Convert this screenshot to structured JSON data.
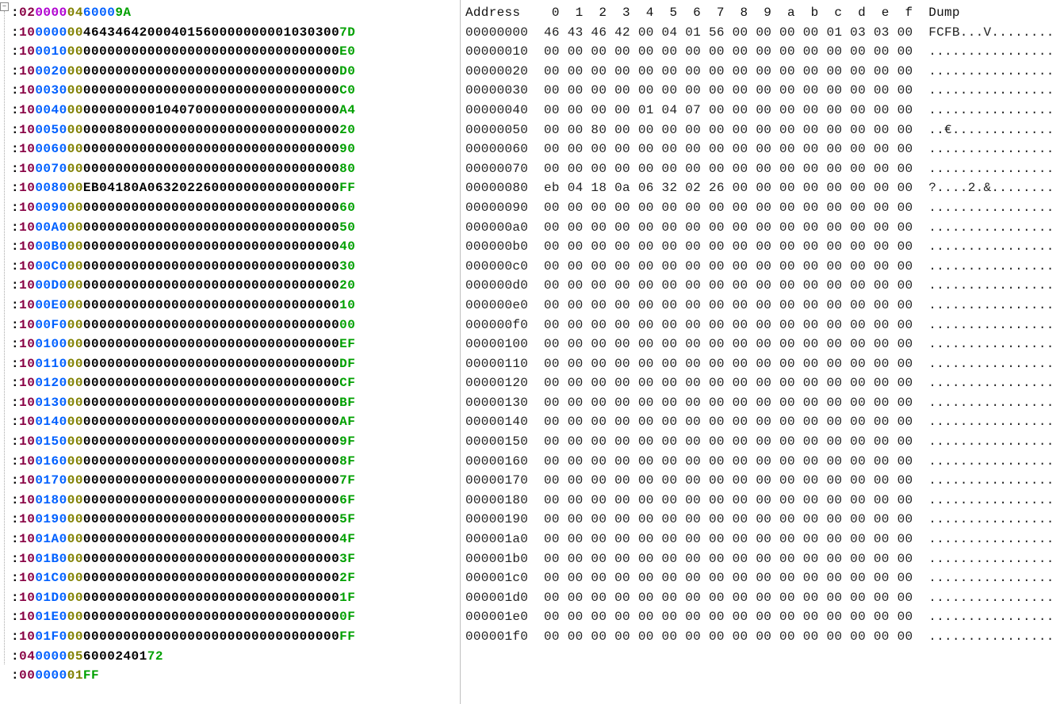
{
  "intel_hex": {
    "first_record": {
      "colon": ":",
      "bc": "02",
      "addr_purple": "0000",
      "type": "04",
      "data_addr_blue": "6000",
      "checksum": "9A"
    },
    "records": [
      {
        "bc": "10",
        "addr": "0000",
        "type": "00",
        "data": "4643464200040156000000000103030",
        "data_tail": "0",
        "ck": "7D"
      },
      {
        "bc": "10",
        "addr": "0010",
        "type": "00",
        "data": "0000000000000000000000000000000",
        "data_tail": "0",
        "ck": "E0"
      },
      {
        "bc": "10",
        "addr": "0020",
        "type": "00",
        "data": "0000000000000000000000000000000",
        "data_tail": "0",
        "ck": "D0"
      },
      {
        "bc": "10",
        "addr": "0030",
        "type": "00",
        "data": "0000000000000000000000000000000",
        "data_tail": "0",
        "ck": "C0"
      },
      {
        "bc": "10",
        "addr": "0040",
        "type": "00",
        "data": "0000000001040700000000000000000",
        "data_tail": "0",
        "ck": "A4"
      },
      {
        "bc": "10",
        "addr": "0050",
        "type": "00",
        "data": "0000800000000000000000000000000",
        "data_tail": "0",
        "ck": "20"
      },
      {
        "bc": "10",
        "addr": "0060",
        "type": "00",
        "data": "0000000000000000000000000000000",
        "data_tail": "0",
        "ck": "90"
      },
      {
        "bc": "10",
        "addr": "0070",
        "type": "00",
        "data": "0000000000000000000000000000000",
        "data_tail": "0",
        "ck": "80"
      },
      {
        "bc": "10",
        "addr": "0080",
        "type": "00",
        "data": "EB04180A06320226000000000000000",
        "data_tail": "0",
        "ck": "FF"
      },
      {
        "bc": "10",
        "addr": "0090",
        "type": "00",
        "data": "0000000000000000000000000000000",
        "data_tail": "0",
        "ck": "60"
      },
      {
        "bc": "10",
        "addr": "00A0",
        "type": "00",
        "data": "0000000000000000000000000000000",
        "data_tail": "0",
        "ck": "50"
      },
      {
        "bc": "10",
        "addr": "00B0",
        "type": "00",
        "data": "0000000000000000000000000000000",
        "data_tail": "0",
        "ck": "40"
      },
      {
        "bc": "10",
        "addr": "00C0",
        "type": "00",
        "data": "0000000000000000000000000000000",
        "data_tail": "0",
        "ck": "30"
      },
      {
        "bc": "10",
        "addr": "00D0",
        "type": "00",
        "data": "0000000000000000000000000000000",
        "data_tail": "0",
        "ck": "20"
      },
      {
        "bc": "10",
        "addr": "00E0",
        "type": "00",
        "data": "0000000000000000000000000000000",
        "data_tail": "0",
        "ck": "10"
      },
      {
        "bc": "10",
        "addr": "00F0",
        "type": "00",
        "data": "0000000000000000000000000000000",
        "data_tail": "0",
        "ck": "00"
      },
      {
        "bc": "10",
        "addr": "0100",
        "type": "00",
        "data": "0000000000000000000000000000000",
        "data_tail": "0",
        "ck": "EF"
      },
      {
        "bc": "10",
        "addr": "0110",
        "type": "00",
        "data": "0000000000000000000000000000000",
        "data_tail": "0",
        "ck": "DF"
      },
      {
        "bc": "10",
        "addr": "0120",
        "type": "00",
        "data": "0000000000000000000000000000000",
        "data_tail": "0",
        "ck": "CF"
      },
      {
        "bc": "10",
        "addr": "0130",
        "type": "00",
        "data": "0000000000000000000000000000000",
        "data_tail": "0",
        "ck": "BF"
      },
      {
        "bc": "10",
        "addr": "0140",
        "type": "00",
        "data": "0000000000000000000000000000000",
        "data_tail": "0",
        "ck": "AF"
      },
      {
        "bc": "10",
        "addr": "0150",
        "type": "00",
        "data": "0000000000000000000000000000000",
        "data_tail": "0",
        "ck": "9F"
      },
      {
        "bc": "10",
        "addr": "0160",
        "type": "00",
        "data": "0000000000000000000000000000000",
        "data_tail": "0",
        "ck": "8F"
      },
      {
        "bc": "10",
        "addr": "0170",
        "type": "00",
        "data": "0000000000000000000000000000000",
        "data_tail": "0",
        "ck": "7F"
      },
      {
        "bc": "10",
        "addr": "0180",
        "type": "00",
        "data": "0000000000000000000000000000000",
        "data_tail": "0",
        "ck": "6F"
      },
      {
        "bc": "10",
        "addr": "0190",
        "type": "00",
        "data": "0000000000000000000000000000000",
        "data_tail": "0",
        "ck": "5F"
      },
      {
        "bc": "10",
        "addr": "01A0",
        "type": "00",
        "data": "0000000000000000000000000000000",
        "data_tail": "0",
        "ck": "4F"
      },
      {
        "bc": "10",
        "addr": "01B0",
        "type": "00",
        "data": "0000000000000000000000000000000",
        "data_tail": "0",
        "ck": "3F"
      },
      {
        "bc": "10",
        "addr": "01C0",
        "type": "00",
        "data": "0000000000000000000000000000000",
        "data_tail": "0",
        "ck": "2F"
      },
      {
        "bc": "10",
        "addr": "01D0",
        "type": "00",
        "data": "0000000000000000000000000000000",
        "data_tail": "0",
        "ck": "1F"
      },
      {
        "bc": "10",
        "addr": "01E0",
        "type": "00",
        "data": "0000000000000000000000000000000",
        "data_tail": "0",
        "ck": "0F"
      },
      {
        "bc": "10",
        "addr": "01F0",
        "type": "00",
        "data": "0000000000000000000000000000000",
        "data_tail": "0",
        "ck": "FF"
      }
    ],
    "trailer": [
      {
        "bc": "04",
        "addr": "0000",
        "type": "05",
        "data": "60002401",
        "ck": "72"
      },
      {
        "bc": "00",
        "addr": "0000",
        "type": "01",
        "data": "",
        "ck": "FF"
      }
    ]
  },
  "hex_dump": {
    "header": {
      "address_label": "Address",
      "columns": [
        "0",
        "1",
        "2",
        "3",
        "4",
        "5",
        "6",
        "7",
        "8",
        "9",
        "a",
        "b",
        "c",
        "d",
        "e",
        "f"
      ],
      "dump_label": "Dump"
    },
    "rows": [
      {
        "addr": "00000000",
        "bytes": [
          "46",
          "43",
          "46",
          "42",
          "00",
          "04",
          "01",
          "56",
          "00",
          "00",
          "00",
          "00",
          "01",
          "03",
          "03",
          "00"
        ],
        "ascii": "FCFB...V........"
      },
      {
        "addr": "00000010",
        "bytes": [
          "00",
          "00",
          "00",
          "00",
          "00",
          "00",
          "00",
          "00",
          "00",
          "00",
          "00",
          "00",
          "00",
          "00",
          "00",
          "00"
        ],
        "ascii": "................"
      },
      {
        "addr": "00000020",
        "bytes": [
          "00",
          "00",
          "00",
          "00",
          "00",
          "00",
          "00",
          "00",
          "00",
          "00",
          "00",
          "00",
          "00",
          "00",
          "00",
          "00"
        ],
        "ascii": "................"
      },
      {
        "addr": "00000030",
        "bytes": [
          "00",
          "00",
          "00",
          "00",
          "00",
          "00",
          "00",
          "00",
          "00",
          "00",
          "00",
          "00",
          "00",
          "00",
          "00",
          "00"
        ],
        "ascii": "................"
      },
      {
        "addr": "00000040",
        "bytes": [
          "00",
          "00",
          "00",
          "00",
          "01",
          "04",
          "07",
          "00",
          "00",
          "00",
          "00",
          "00",
          "00",
          "00",
          "00",
          "00"
        ],
        "ascii": "................"
      },
      {
        "addr": "00000050",
        "bytes": [
          "00",
          "00",
          "80",
          "00",
          "00",
          "00",
          "00",
          "00",
          "00",
          "00",
          "00",
          "00",
          "00",
          "00",
          "00",
          "00"
        ],
        "ascii": "..€............."
      },
      {
        "addr": "00000060",
        "bytes": [
          "00",
          "00",
          "00",
          "00",
          "00",
          "00",
          "00",
          "00",
          "00",
          "00",
          "00",
          "00",
          "00",
          "00",
          "00",
          "00"
        ],
        "ascii": "................"
      },
      {
        "addr": "00000070",
        "bytes": [
          "00",
          "00",
          "00",
          "00",
          "00",
          "00",
          "00",
          "00",
          "00",
          "00",
          "00",
          "00",
          "00",
          "00",
          "00",
          "00"
        ],
        "ascii": "................"
      },
      {
        "addr": "00000080",
        "bytes": [
          "eb",
          "04",
          "18",
          "0a",
          "06",
          "32",
          "02",
          "26",
          "00",
          "00",
          "00",
          "00",
          "00",
          "00",
          "00",
          "00"
        ],
        "ascii": "?....2.&........"
      },
      {
        "addr": "00000090",
        "bytes": [
          "00",
          "00",
          "00",
          "00",
          "00",
          "00",
          "00",
          "00",
          "00",
          "00",
          "00",
          "00",
          "00",
          "00",
          "00",
          "00"
        ],
        "ascii": "................"
      },
      {
        "addr": "000000a0",
        "bytes": [
          "00",
          "00",
          "00",
          "00",
          "00",
          "00",
          "00",
          "00",
          "00",
          "00",
          "00",
          "00",
          "00",
          "00",
          "00",
          "00"
        ],
        "ascii": "................"
      },
      {
        "addr": "000000b0",
        "bytes": [
          "00",
          "00",
          "00",
          "00",
          "00",
          "00",
          "00",
          "00",
          "00",
          "00",
          "00",
          "00",
          "00",
          "00",
          "00",
          "00"
        ],
        "ascii": "................"
      },
      {
        "addr": "000000c0",
        "bytes": [
          "00",
          "00",
          "00",
          "00",
          "00",
          "00",
          "00",
          "00",
          "00",
          "00",
          "00",
          "00",
          "00",
          "00",
          "00",
          "00"
        ],
        "ascii": "................"
      },
      {
        "addr": "000000d0",
        "bytes": [
          "00",
          "00",
          "00",
          "00",
          "00",
          "00",
          "00",
          "00",
          "00",
          "00",
          "00",
          "00",
          "00",
          "00",
          "00",
          "00"
        ],
        "ascii": "................"
      },
      {
        "addr": "000000e0",
        "bytes": [
          "00",
          "00",
          "00",
          "00",
          "00",
          "00",
          "00",
          "00",
          "00",
          "00",
          "00",
          "00",
          "00",
          "00",
          "00",
          "00"
        ],
        "ascii": "................"
      },
      {
        "addr": "000000f0",
        "bytes": [
          "00",
          "00",
          "00",
          "00",
          "00",
          "00",
          "00",
          "00",
          "00",
          "00",
          "00",
          "00",
          "00",
          "00",
          "00",
          "00"
        ],
        "ascii": "................"
      },
      {
        "addr": "00000100",
        "bytes": [
          "00",
          "00",
          "00",
          "00",
          "00",
          "00",
          "00",
          "00",
          "00",
          "00",
          "00",
          "00",
          "00",
          "00",
          "00",
          "00"
        ],
        "ascii": "................"
      },
      {
        "addr": "00000110",
        "bytes": [
          "00",
          "00",
          "00",
          "00",
          "00",
          "00",
          "00",
          "00",
          "00",
          "00",
          "00",
          "00",
          "00",
          "00",
          "00",
          "00"
        ],
        "ascii": "................"
      },
      {
        "addr": "00000120",
        "bytes": [
          "00",
          "00",
          "00",
          "00",
          "00",
          "00",
          "00",
          "00",
          "00",
          "00",
          "00",
          "00",
          "00",
          "00",
          "00",
          "00"
        ],
        "ascii": "................"
      },
      {
        "addr": "00000130",
        "bytes": [
          "00",
          "00",
          "00",
          "00",
          "00",
          "00",
          "00",
          "00",
          "00",
          "00",
          "00",
          "00",
          "00",
          "00",
          "00",
          "00"
        ],
        "ascii": "................"
      },
      {
        "addr": "00000140",
        "bytes": [
          "00",
          "00",
          "00",
          "00",
          "00",
          "00",
          "00",
          "00",
          "00",
          "00",
          "00",
          "00",
          "00",
          "00",
          "00",
          "00"
        ],
        "ascii": "................"
      },
      {
        "addr": "00000150",
        "bytes": [
          "00",
          "00",
          "00",
          "00",
          "00",
          "00",
          "00",
          "00",
          "00",
          "00",
          "00",
          "00",
          "00",
          "00",
          "00",
          "00"
        ],
        "ascii": "................"
      },
      {
        "addr": "00000160",
        "bytes": [
          "00",
          "00",
          "00",
          "00",
          "00",
          "00",
          "00",
          "00",
          "00",
          "00",
          "00",
          "00",
          "00",
          "00",
          "00",
          "00"
        ],
        "ascii": "................"
      },
      {
        "addr": "00000170",
        "bytes": [
          "00",
          "00",
          "00",
          "00",
          "00",
          "00",
          "00",
          "00",
          "00",
          "00",
          "00",
          "00",
          "00",
          "00",
          "00",
          "00"
        ],
        "ascii": "................"
      },
      {
        "addr": "00000180",
        "bytes": [
          "00",
          "00",
          "00",
          "00",
          "00",
          "00",
          "00",
          "00",
          "00",
          "00",
          "00",
          "00",
          "00",
          "00",
          "00",
          "00"
        ],
        "ascii": "................"
      },
      {
        "addr": "00000190",
        "bytes": [
          "00",
          "00",
          "00",
          "00",
          "00",
          "00",
          "00",
          "00",
          "00",
          "00",
          "00",
          "00",
          "00",
          "00",
          "00",
          "00"
        ],
        "ascii": "................"
      },
      {
        "addr": "000001a0",
        "bytes": [
          "00",
          "00",
          "00",
          "00",
          "00",
          "00",
          "00",
          "00",
          "00",
          "00",
          "00",
          "00",
          "00",
          "00",
          "00",
          "00"
        ],
        "ascii": "................"
      },
      {
        "addr": "000001b0",
        "bytes": [
          "00",
          "00",
          "00",
          "00",
          "00",
          "00",
          "00",
          "00",
          "00",
          "00",
          "00",
          "00",
          "00",
          "00",
          "00",
          "00"
        ],
        "ascii": "................"
      },
      {
        "addr": "000001c0",
        "bytes": [
          "00",
          "00",
          "00",
          "00",
          "00",
          "00",
          "00",
          "00",
          "00",
          "00",
          "00",
          "00",
          "00",
          "00",
          "00",
          "00"
        ],
        "ascii": "................"
      },
      {
        "addr": "000001d0",
        "bytes": [
          "00",
          "00",
          "00",
          "00",
          "00",
          "00",
          "00",
          "00",
          "00",
          "00",
          "00",
          "00",
          "00",
          "00",
          "00",
          "00"
        ],
        "ascii": "................"
      },
      {
        "addr": "000001e0",
        "bytes": [
          "00",
          "00",
          "00",
          "00",
          "00",
          "00",
          "00",
          "00",
          "00",
          "00",
          "00",
          "00",
          "00",
          "00",
          "00",
          "00"
        ],
        "ascii": "................"
      },
      {
        "addr": "000001f0",
        "bytes": [
          "00",
          "00",
          "00",
          "00",
          "00",
          "00",
          "00",
          "00",
          "00",
          "00",
          "00",
          "00",
          "00",
          "00",
          "00",
          "00"
        ],
        "ascii": "................"
      }
    ]
  },
  "tree_toggle_glyph": "–"
}
